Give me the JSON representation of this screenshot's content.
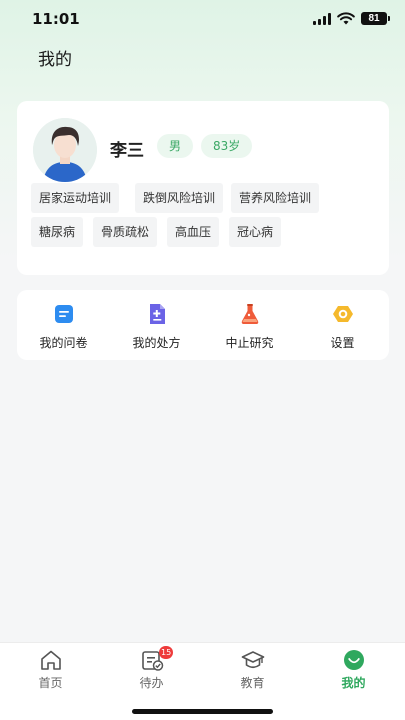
{
  "status_bar": {
    "time": "11:01",
    "battery": "81"
  },
  "page": {
    "title": "我的"
  },
  "profile": {
    "name": "李三",
    "gender": "男",
    "age": "83岁",
    "tags": [
      "居家运动培训",
      "跌倒风险培训",
      "营养风险培训",
      "糖尿病",
      "骨质疏松",
      "高血压",
      "冠心病"
    ]
  },
  "menu": {
    "items": [
      {
        "label": "我的问卷",
        "icon": "questionnaire-icon",
        "color": "#2d8cf0"
      },
      {
        "label": "我的处方",
        "icon": "prescription-icon",
        "color": "#6b63e6"
      },
      {
        "label": "中止研究",
        "icon": "flask-icon",
        "color": "#ef5b3a"
      },
      {
        "label": "设置",
        "icon": "settings-icon",
        "color": "#f5b92c"
      }
    ]
  },
  "tabbar": {
    "items": [
      {
        "label": "首页",
        "icon": "home-icon",
        "active": false
      },
      {
        "label": "待办",
        "icon": "todo-icon",
        "active": false,
        "badge": "15"
      },
      {
        "label": "教育",
        "icon": "graduation-cap-icon",
        "active": false
      },
      {
        "label": "我的",
        "icon": "profile-smile-icon",
        "active": true
      }
    ]
  },
  "colors": {
    "accent": "#2fa85e",
    "badge_bg": "#ebf7ef",
    "alert": "#ee3b3b"
  }
}
